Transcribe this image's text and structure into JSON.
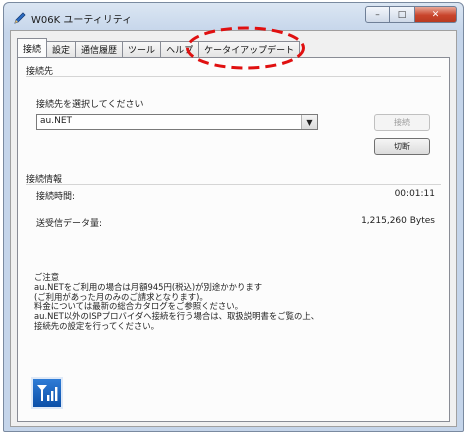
{
  "window": {
    "title": "W06K ユーティリティ",
    "controls": {
      "minimize": "–",
      "maximize": "□",
      "close": "✕"
    },
    "app_icon": "pen-icon"
  },
  "tabs": [
    {
      "label": "接続",
      "active": true
    },
    {
      "label": "設定",
      "active": false
    },
    {
      "label": "通信履歴",
      "active": false
    },
    {
      "label": "ツール",
      "active": false
    },
    {
      "label": "ヘルプ",
      "active": false
    },
    {
      "label": "ケータイアップデート",
      "active": false
    }
  ],
  "connection": {
    "group_title": "接続先",
    "select_label": "接続先を選択してください",
    "selected_value": "au.NET",
    "connect_label": "接続",
    "disconnect_label": "切断"
  },
  "info": {
    "group_title": "接続情報",
    "time_label": "接続時間:",
    "time_value": "00:01:11",
    "data_label": "送受信データ量:",
    "data_value": "1,215,260 Bytes"
  },
  "notice": {
    "lines": [
      "ご注意",
      "au.NETをご利用の場合は月額945円(税込)が別途かかります",
      "(ご利用があった月のみのご請求となります)。",
      "料金については最新の総合カタログをご参照ください。",
      "au.NET以外のISPプロバイダへ接続を行う場合は、取扱説明書をご覧の上、",
      "接続先の設定を行ってください。"
    ]
  },
  "colors": {
    "annotation": "#e01010",
    "accent": "#0b4fa8"
  },
  "icons": {
    "app_tile": "signal-app-icon"
  }
}
